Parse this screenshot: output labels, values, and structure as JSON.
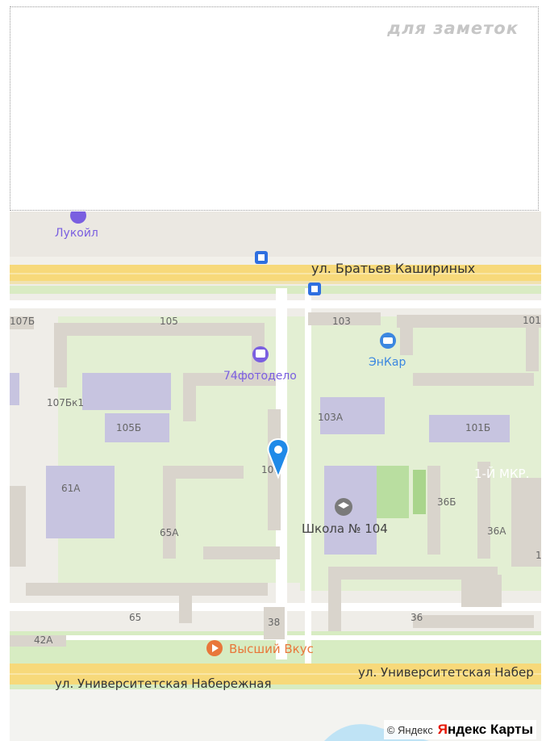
{
  "notes": {
    "label": "для заметок"
  },
  "map": {
    "streets": [
      {
        "id": "street-kashirinykh",
        "text": "ул. Братьев Кашириных"
      },
      {
        "id": "street-univ-1",
        "text": "ул. Университетская Набер"
      },
      {
        "id": "street-univ-2",
        "text": "ул. Университетская Набережная"
      }
    ],
    "pois": [
      {
        "id": "poi-lukoil",
        "text": "Лукойл",
        "color": "#7a5fe0"
      },
      {
        "id": "poi-74fotodelo",
        "text": "74фотодело",
        "color": "#7a5fe0"
      },
      {
        "id": "poi-enkar",
        "text": "ЭнКар",
        "color": "#3b87e0"
      },
      {
        "id": "poi-school",
        "text": "Школа № 104",
        "color": "#444444"
      },
      {
        "id": "poi-vysshiy",
        "text": "Высший Вкус",
        "color": "#e8773a"
      }
    ],
    "district": "1-Й МКР.",
    "buildings": [
      "107Б",
      "105",
      "103",
      "101",
      "107Бк1",
      "105Б",
      "103А",
      "101Б",
      "107",
      "61А",
      "36Б",
      "65А",
      "36А",
      "1",
      "65",
      "36",
      "38",
      "42А"
    ]
  },
  "footer": {
    "copyright": "© Яндекс",
    "brand_first": "Я",
    "brand_rest": "ндекс Карты"
  },
  "colors": {
    "road_yellow": "#f7d97a",
    "greenery": "#cfe8b5",
    "building": "#d9d4cc",
    "school_building": "#c7c4e0"
  }
}
